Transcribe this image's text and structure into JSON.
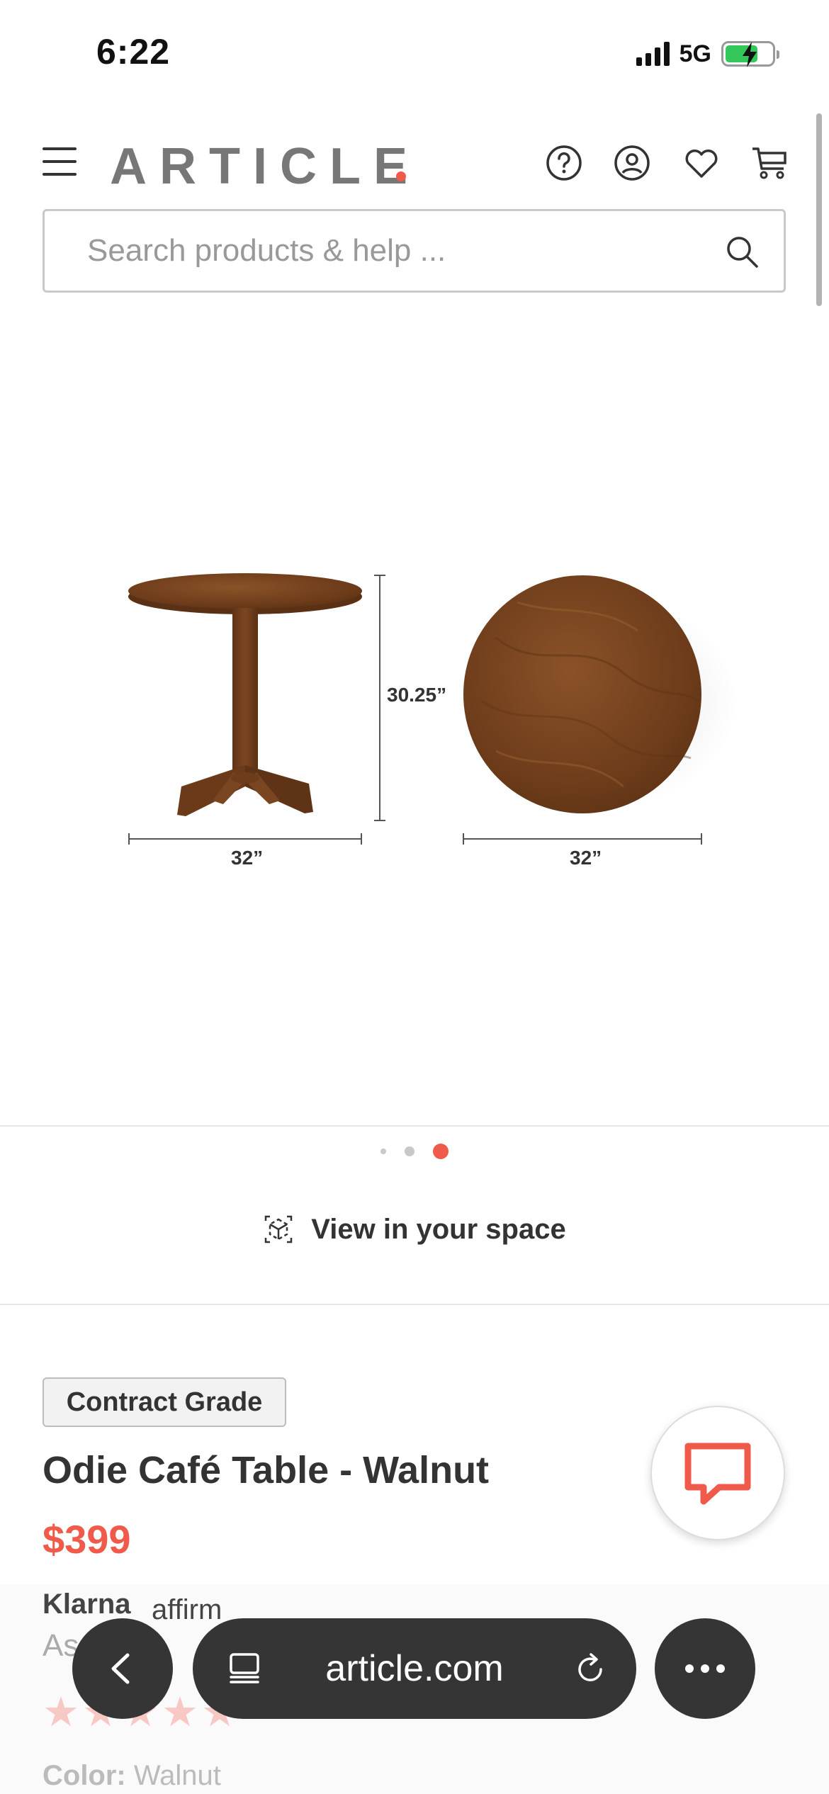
{
  "status_bar": {
    "time": "6:22",
    "network": "5G",
    "battery_level": 0.7
  },
  "header": {
    "logo": "ARTICLE",
    "icons": [
      "menu-icon",
      "help-icon",
      "account-icon",
      "wishlist-heart-icon",
      "cart-icon"
    ]
  },
  "search": {
    "placeholder": "Search products & help ..."
  },
  "product_image": {
    "height_label": "30.25”",
    "width_label_side": "32”",
    "width_label_top": "32”"
  },
  "carousel": {
    "count": 3,
    "active_index": 2
  },
  "view_in_space": {
    "label": "View in your space"
  },
  "product": {
    "badge": "Contract Grade",
    "title": "Odie Café Table - Walnut",
    "price": "$399",
    "financing_brands": [
      "Klarna",
      "affirm"
    ],
    "financing_text": "As",
    "color_label": "Color:",
    "color_value": "Walnut"
  },
  "browser": {
    "url": "article.com"
  },
  "colors": {
    "accent": "#f05a4a",
    "text": "#333333",
    "wood": "#7a4521"
  }
}
